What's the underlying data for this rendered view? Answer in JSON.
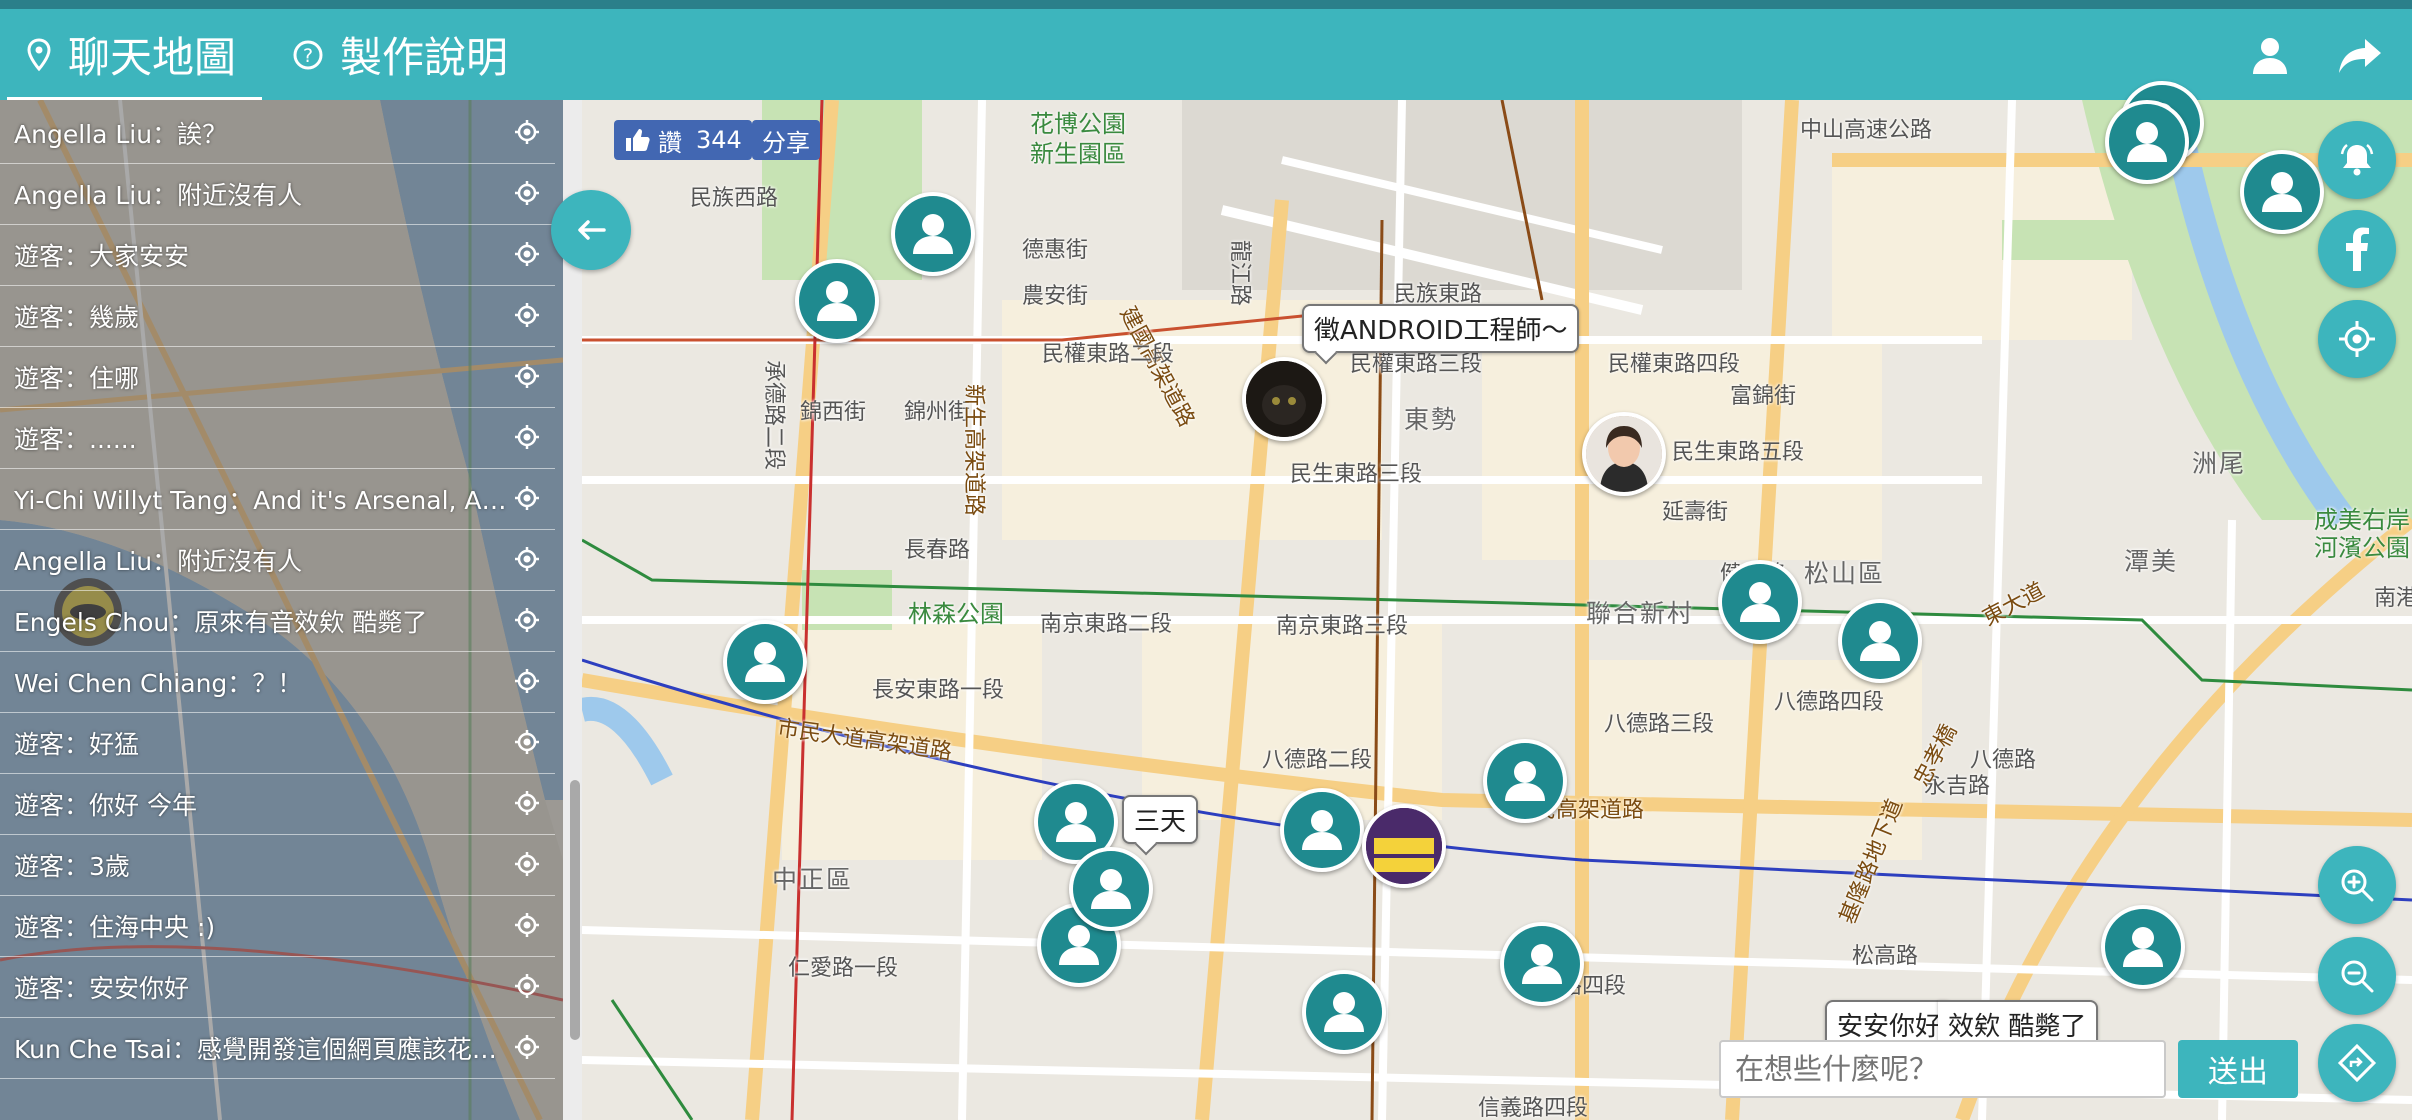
{
  "header": {
    "tabs": [
      {
        "label": "聊天地圖",
        "icon": "map-pin-icon",
        "active": true
      },
      {
        "label": "製作說明",
        "icon": "help-circle-icon",
        "active": false
      }
    ],
    "right_icons": [
      "user-icon",
      "share-arrow-icon"
    ],
    "accent_color": "#3db5bd"
  },
  "chat": {
    "messages": [
      {
        "text": "Angella Liu：誒？"
      },
      {
        "text": "Angella Liu：附近沒有人"
      },
      {
        "text": "遊客：大家安安"
      },
      {
        "text": "遊客：幾歲"
      },
      {
        "text": "遊客：住哪"
      },
      {
        "text": "遊客：......"
      },
      {
        "text": "Yi-Chi Willyt Tang：And it's Arsenal, Arsenal"
      },
      {
        "text": "Angella Liu：附近沒有人"
      },
      {
        "text": "Engels Chou：原來有音效欸 酷斃了"
      },
      {
        "text": "Wei Chen Chiang：？！"
      },
      {
        "text": "遊客：好猛"
      },
      {
        "text": "遊客：你好 今年"
      },
      {
        "text": "遊客：3歲"
      },
      {
        "text": "遊客：住海中央 :)"
      },
      {
        "text": "遊客：安安你好"
      },
      {
        "text": "Kun Che Tsai：感覺開發這個網頁應該花了很多時間"
      }
    ]
  },
  "facebook": {
    "like_label": "讚",
    "like_count": "344",
    "share_label": "分享"
  },
  "map": {
    "bubbles": {
      "android": "徵ANDROID工程師～",
      "three_days": "三天",
      "hello": "安安你好",
      "cool_tail": "效欸 酷斃了"
    },
    "labels": {
      "park1": "花博公園",
      "park2": "新生園區",
      "highway_n": "中山高速公路",
      "minzu_w": "民族西路",
      "dehui": "德惠街",
      "nongan": "農安街",
      "jianguo_elev": "建國高架道路",
      "minquan_e2": "民權東路二段",
      "minquan_e3": "民權東路三段",
      "minquan_e4": "民權東路四段",
      "longjiang": "龍江路",
      "minzu_e": "民族東路",
      "chengde": "承德路二段",
      "jinxi": "錦西街",
      "jinzhou": "錦州街",
      "xinsheng_elev": "新生高架道路",
      "dongshi": "東勢",
      "minsheng_e3": "民生東路三段",
      "minsheng_e5": "民生東路五段",
      "yanshou": "延壽街",
      "fujin": "富錦街",
      "changchun": "長春路",
      "linsen_park": "林森公園",
      "nanjing_e2": "南京東路二段",
      "nanjing_e3": "南京東路三段",
      "lianhe": "聯合新村",
      "jiankang": "健康路",
      "songshan": "松山區",
      "bade_e3": "八德路三段",
      "bade_e4": "八德路四段",
      "bade_e2": "八德路二段",
      "changan_e1": "長安東路一段",
      "civic_elev": "市民大道高架道路",
      "civic_elev2": "市民高架道路",
      "zhongzheng": "中正區",
      "ren_ai": "仁愛路一段",
      "ren_ai4": "仁愛路四段",
      "songgao": "松高路",
      "yongji": "永吉路",
      "jilong": "基隆路地下道",
      "zhongpo": "東大道",
      "zhouwei": "洲尾",
      "chengmei": "成美右岸",
      "chengmei2": "河濱公園",
      "tanmei": "潭美",
      "bade_civic": "八德路",
      "xinyi": "信義路四段",
      "zhongxiao": "忠孝橋",
      "nangang": "南港"
    }
  },
  "input": {
    "placeholder": "在想些什麼呢？",
    "send_label": "送出"
  },
  "side_buttons": [
    "bell-icon",
    "facebook-icon",
    "locate-icon",
    "zoom-in-icon",
    "zoom-out-icon",
    "directions-icon"
  ]
}
